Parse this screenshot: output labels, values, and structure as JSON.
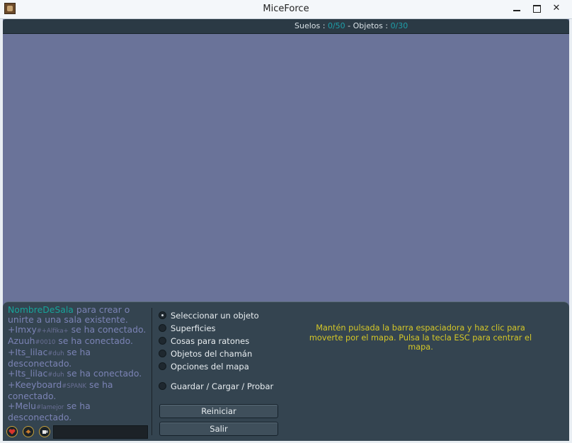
{
  "window": {
    "title": "MiceForce",
    "controls": {
      "minimize": "minimize-icon",
      "maximize": "maximize-icon",
      "close": "✕"
    }
  },
  "counter": {
    "floors_label": "Suelos : ",
    "floors_value": "0/50",
    "separator": " - ",
    "objects_label": "Objetos : ",
    "objects_value": "0/30"
  },
  "chat": {
    "intro": {
      "room": "NombreDeSala",
      "text": " para crear o unirte a una sala existente."
    },
    "messages": [
      {
        "name": "+Imxy",
        "tag": "#+Alfika+",
        "text": " se ha conectado."
      },
      {
        "name": "Azuuh",
        "tag": "#0010",
        "text": " se ha conectado."
      },
      {
        "name": "+Its_lilac",
        "tag": "#duh",
        "text": " se ha desconectado."
      },
      {
        "name": "+Its_lilac",
        "tag": "#duh",
        "text": " se ha conectado."
      },
      {
        "name": "+Keeyboard",
        "tag": "#SPANK",
        "text": " se ha conectado."
      },
      {
        "name": "+Melu",
        "tag": "#lamejor",
        "text": " se ha desconectado."
      }
    ],
    "icons": [
      "heart-icon",
      "shaman-icon",
      "cup-icon"
    ],
    "input_value": ""
  },
  "options": {
    "selected": "Seleccionar un objeto",
    "items": [
      "Seleccionar un objeto",
      "Superficies",
      "Cosas para ratones",
      "Objetos del chamán",
      "Opciones del mapa",
      "Guardar / Cargar / Probar"
    ]
  },
  "buttons": {
    "reiniciar": "Reiniciar",
    "salir": "Salir"
  },
  "help_text": "Mantén pulsada la barra espaciadora y haz clic para moverte por el mapa. Pulsa la tecla ESC para centrar el mapa.",
  "colors": {
    "accent_cyan": "#1e9fa9",
    "help_yellow": "#d4c728",
    "map_bg": "#6a7399",
    "panel_bg": "#344450"
  }
}
